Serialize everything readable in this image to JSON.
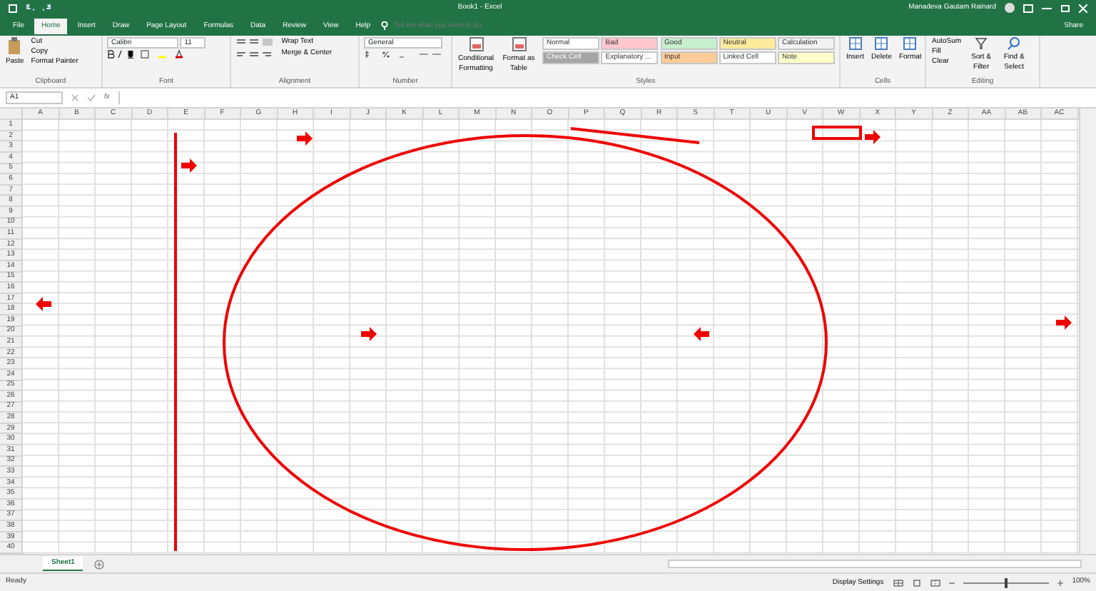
{
  "title_bar": {
    "title": "Book1  -  Excel",
    "user": "Manadeva Gautam Rainard"
  },
  "tabs": [
    {
      "label": "File",
      "selected": false
    },
    {
      "label": "Home",
      "selected": true
    },
    {
      "label": "Insert",
      "selected": false
    },
    {
      "label": "Draw",
      "selected": false
    },
    {
      "label": "Page Layout",
      "selected": false
    },
    {
      "label": "Formulas",
      "selected": false
    },
    {
      "label": "Data",
      "selected": false
    },
    {
      "label": "Review",
      "selected": false
    },
    {
      "label": "View",
      "selected": false
    },
    {
      "label": "Help",
      "selected": false
    }
  ],
  "tell_me": {
    "placeholder": "Tell me what you want to do"
  },
  "share": "Share",
  "ribbon": {
    "clipboard": {
      "label": "Clipboard",
      "paste": "Paste",
      "items": [
        "Cut",
        "Copy",
        "Format Painter"
      ]
    },
    "font": {
      "label": "Font",
      "font_name": "Calibri",
      "font_size": "11"
    },
    "alignment": {
      "label": "Alignment",
      "items": [
        "Wrap Text",
        "Merge & Center"
      ]
    },
    "number": {
      "label": "Number",
      "format": "General"
    },
    "styles": {
      "label": "Styles",
      "buttons": [
        "Conditional Formatting",
        "Format as Table"
      ],
      "cell_styles": [
        {
          "label": "Normal",
          "color": "#ffffff"
        },
        {
          "label": "Bad",
          "color": "#ffc7ce"
        },
        {
          "label": "Good",
          "color": "#c6efce"
        },
        {
          "label": "Neutral",
          "color": "#ffeb9c"
        },
        {
          "label": "Calculation",
          "color": "#f2f2f2"
        },
        {
          "label": "Check Cell",
          "color": "#a5a5a5"
        },
        {
          "label": "Explanatory ...",
          "color": "#ffffff"
        },
        {
          "label": "Input",
          "color": "#ffcc99"
        },
        {
          "label": "Linked Cell",
          "color": "#ffffff"
        },
        {
          "label": "Note",
          "color": "#ffffcc"
        }
      ]
    },
    "cells": {
      "label": "Cells",
      "items": [
        "Insert",
        "Delete",
        "Format"
      ]
    },
    "editing": {
      "label": "Editing",
      "items": [
        "AutoSum",
        "Fill",
        "Clear"
      ],
      "big": [
        "Sort & Filter",
        "Find & Select"
      ]
    }
  },
  "formula_bar": {
    "name_box": "A1",
    "fx": "fx"
  },
  "sheet": {
    "columns": [
      "A",
      "B",
      "C",
      "D",
      "E",
      "F",
      "G",
      "H",
      "I",
      "J",
      "K",
      "L",
      "M",
      "N",
      "O",
      "P",
      "Q",
      "R",
      "S",
      "T",
      "U",
      "V",
      "W",
      "X",
      "Y",
      "Z",
      "AA",
      "AB",
      "AC"
    ],
    "rows": [
      "1",
      "2",
      "3",
      "4",
      "5",
      "6",
      "7",
      "8",
      "9",
      "10",
      "11",
      "12",
      "13",
      "14",
      "15",
      "16",
      "17",
      "18",
      "19",
      "20",
      "21",
      "22",
      "23",
      "24",
      "25",
      "26",
      "27",
      "28",
      "29",
      "30",
      "31",
      "32",
      "33",
      "34",
      "35",
      "36",
      "37",
      "38",
      "39",
      "40"
    ]
  },
  "sheet_tabs": [
    {
      "label": "Sheet1",
      "selected": true
    }
  ],
  "status_bar": {
    "status": "Ready",
    "display_settings": "Display Settings",
    "zoom": {
      "level": 0.5,
      "reading": "100%"
    }
  }
}
